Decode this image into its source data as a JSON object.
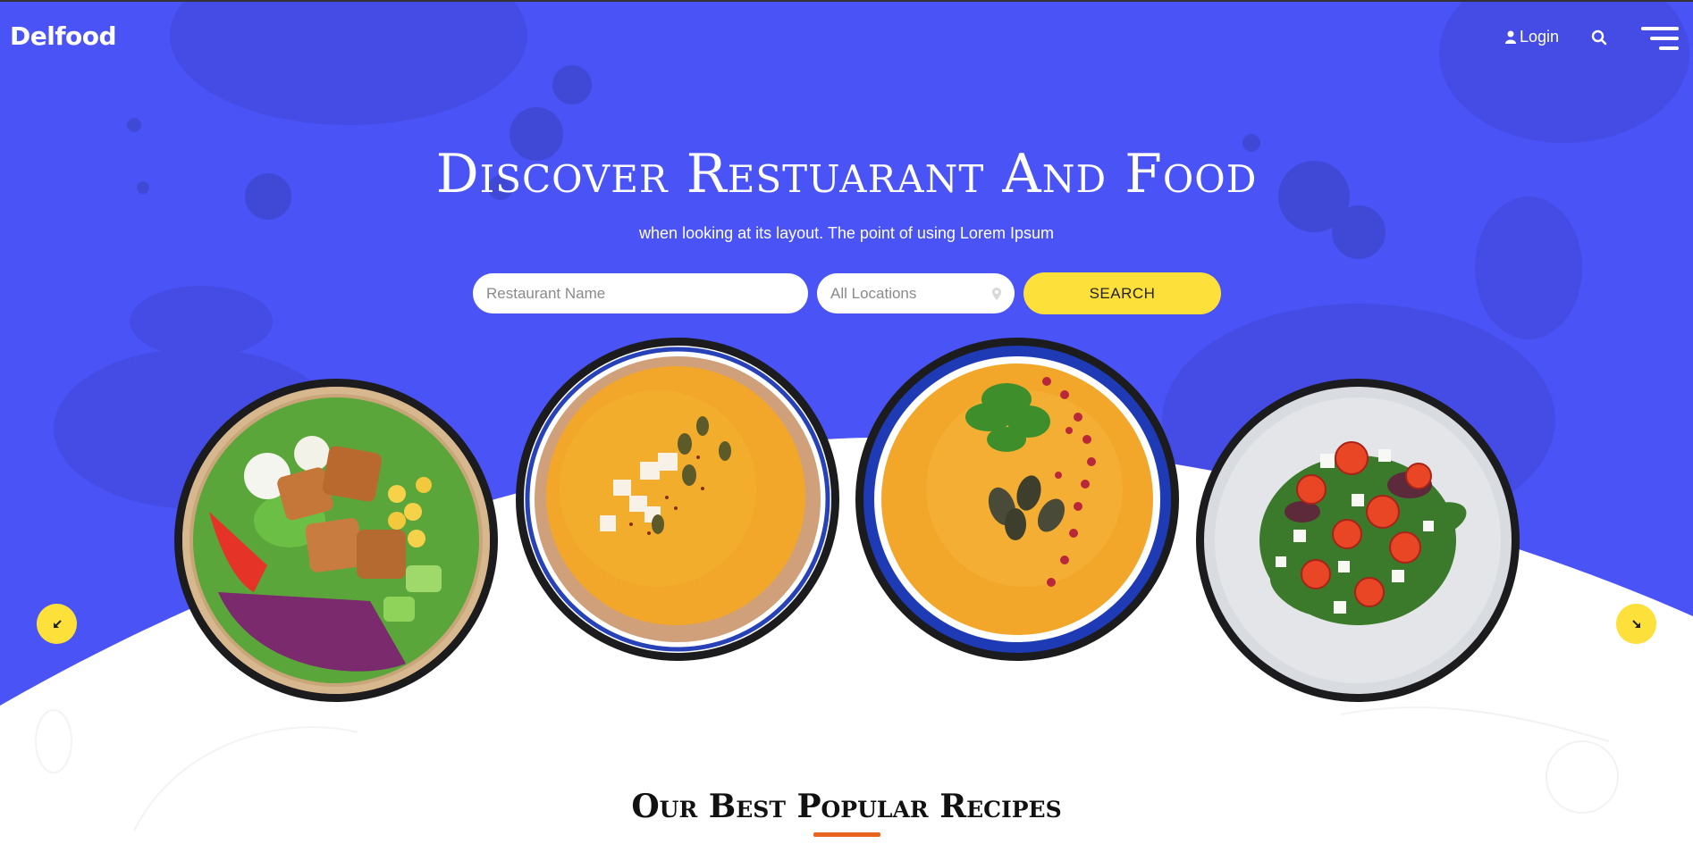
{
  "brand": {
    "name": "Delfood"
  },
  "nav": {
    "login_label": "Login",
    "icons": [
      "user-icon",
      "search-icon",
      "menu-icon"
    ]
  },
  "hero": {
    "title": "Discover Restuarant And Food",
    "subtitle": "when looking at its layout. The point of using Lorem Ipsum"
  },
  "search": {
    "name_placeholder": "Restaurant Name",
    "location_selected": "All Locations",
    "button_label": "SEARCH"
  },
  "carousel": {
    "items": [
      "salad-bowl",
      "pumpkin-soup",
      "carrot-soup",
      "greek-salad"
    ],
    "prev_icon": "arrow-down-left-icon",
    "next_icon": "arrow-down-right-icon"
  },
  "section": {
    "title": "Our Best Popular Recipes"
  },
  "colors": {
    "hero_blue": "#4a53f5",
    "accent_yellow": "#fde03a",
    "underline_orange": "#e8641f"
  }
}
